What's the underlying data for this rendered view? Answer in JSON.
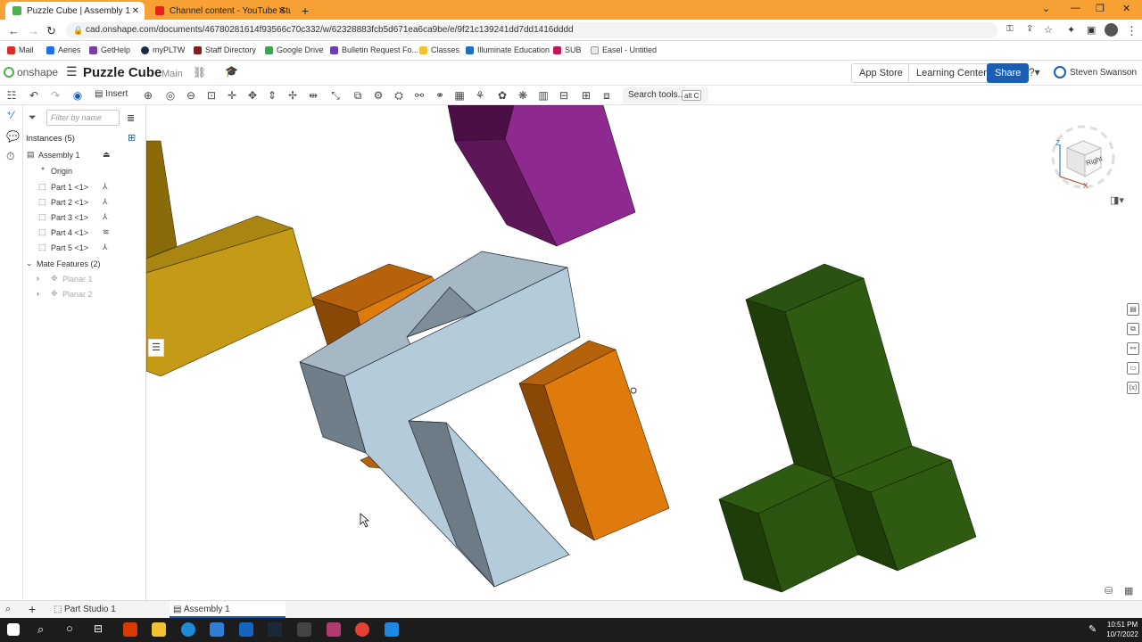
{
  "browser": {
    "tabs": [
      {
        "title": "Puzzle Cube | Assembly 1",
        "active": true
      },
      {
        "title": "Channel content - YouTube Studi",
        "active": false
      }
    ],
    "new_tab": "+",
    "url": "cad.onshape.com/documents/46780281614f93566c70c332/w/62328883fcb5d671ea6ca9be/e/9f21c139241dd7dd1416dddd",
    "bookmarks": [
      "Mail",
      "Aeries",
      "GetHelp",
      "myPLTW",
      "Staff Directory",
      "Google Drive",
      "Bulletin Request Fo...",
      "Classes",
      "Illuminate Education",
      "SUB",
      "Easel - Untitled"
    ]
  },
  "app": {
    "logo": "onshape",
    "doc_title": "Puzzle Cube",
    "branch": "Main",
    "app_store": "App Store",
    "learning_center": "Learning Center",
    "share": "Share",
    "user": "Steven Swanson"
  },
  "toolbar": {
    "insert": "Insert",
    "search_tools": "Search tools...",
    "search_shortcut": "alt C"
  },
  "panel": {
    "filter_placeholder": "Filter by name",
    "instances_label": "Instances (5)",
    "assembly": "Assembly 1",
    "origin": "Origin",
    "parts": [
      "Part 1 <1>",
      "Part 2 <1>",
      "Part 3 <1>",
      "Part 4 <1>",
      "Part 5 <1>"
    ],
    "mate_features": "Mate Features (2)",
    "mates": [
      "Planar 1",
      "Planar 2"
    ]
  },
  "viewcube": {
    "face": "Right",
    "axis_z": "Z",
    "axis_x": "X"
  },
  "bottom_tabs": [
    "Part Studio 1",
    "Assembly 1"
  ],
  "clock": {
    "time": "10:51 PM",
    "date": "10/7/2022"
  },
  "colors": {
    "chrome_tab_bar": "#f7a033",
    "share_button": "#1a5fb4",
    "part_gold": "#c49a17",
    "part_purple": "#8e2a8f",
    "part_orange": "#df7a0c",
    "part_light_blue": "#b4cbd9",
    "part_green": "#2f5a12"
  }
}
